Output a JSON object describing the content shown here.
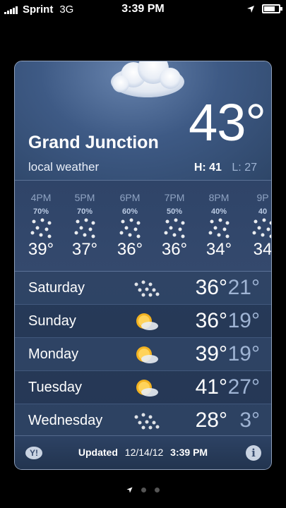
{
  "status_bar": {
    "carrier": "Sprint",
    "network": "3G",
    "time": "3:39 PM"
  },
  "weather": {
    "city": "Grand Junction",
    "subtitle": "local weather",
    "current_temp": "43°",
    "high": "H: 41",
    "low": "L: 27",
    "current_icon": "cloud-icon"
  },
  "hourly": [
    {
      "time": "4PM",
      "chance": "70%",
      "temp": "39°",
      "icon": "snow-icon"
    },
    {
      "time": "5PM",
      "chance": "70%",
      "temp": "37°",
      "icon": "snow-icon"
    },
    {
      "time": "6PM",
      "chance": "60%",
      "temp": "36°",
      "icon": "snow-icon"
    },
    {
      "time": "7PM",
      "chance": "50%",
      "temp": "36°",
      "icon": "snow-icon"
    },
    {
      "time": "8PM",
      "chance": "40%",
      "temp": "34°",
      "icon": "snow-icon"
    },
    {
      "time": "9P",
      "chance": "40",
      "temp": "34",
      "icon": "snow-icon"
    }
  ],
  "daily": [
    {
      "day": "Saturday",
      "high": "36°",
      "low": "21°",
      "icon": "snow-icon"
    },
    {
      "day": "Sunday",
      "high": "36°",
      "low": "19°",
      "icon": "partly-sunny-icon"
    },
    {
      "day": "Monday",
      "high": "39°",
      "low": "19°",
      "icon": "partly-sunny-icon"
    },
    {
      "day": "Tuesday",
      "high": "41°",
      "low": "27°",
      "icon": "partly-sunny-icon"
    },
    {
      "day": "Wednesday",
      "high": "28°",
      "low": "3°",
      "icon": "snow-icon"
    }
  ],
  "footer": {
    "updated_label": "Updated",
    "updated_date": "12/14/12",
    "updated_time": "3:39 PM",
    "logo": "Y!",
    "info": "i"
  },
  "colors": {
    "card_top": "#3b5680",
    "card_bottom": "#243754",
    "low_temp": "#9fb4d4"
  }
}
